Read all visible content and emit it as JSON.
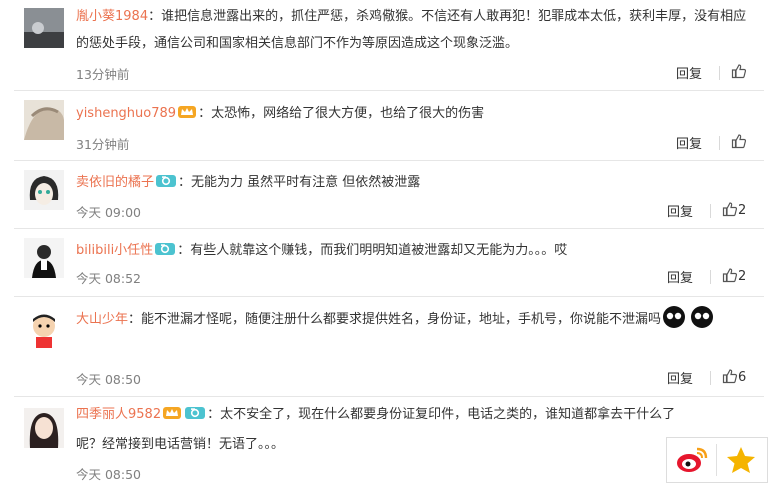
{
  "comments": [
    {
      "user": "胤小葵1984",
      "text": "：谁把信息泄露出来的，抓住严惩，杀鸡儆猴。不信还有人敢再犯！犯罪成本太低，获利丰厚，没有相应的惩处手段，通信公司和国家相关信息部门不作为等原因造成这个现象泛滥。",
      "time": "13分钟前",
      "reply": "回复",
      "likes": ""
    },
    {
      "user": "yishenghuo789",
      "text": "：太恐怖，网络给了很大方便，也给了很大的伤害",
      "time": "31分钟前",
      "reply": "回复",
      "likes": ""
    },
    {
      "user": "卖依旧的橘子",
      "text": "：无能为力 虽然平时有注意 但依然被泄露",
      "time": "今天 09:00",
      "reply": "回复",
      "likes": "2"
    },
    {
      "user": "bilibili小任性",
      "text": "：有些人就靠这个赚钱，而我们明明知道被泄露却又无能为力。。。哎",
      "time": "今天 08:52",
      "reply": "回复",
      "likes": "2"
    },
    {
      "user": "大山少年",
      "text": "：能不泄漏才怪呢，随便注册什么都要求提供姓名，身份证，地址，手机号，你说能不泄漏吗",
      "time": "今天 08:50",
      "reply": "回复",
      "likes": "6"
    },
    {
      "user": "四季丽人9582",
      "text": "：太不安全了，现在什么都要身份证复印件，电话之类的，谁知道都拿去干什么了呢？经常接到电话营销！无语了。。。",
      "time": "今天 08:50",
      "reply": "",
      "likes": ""
    }
  ],
  "colors": {
    "username": "#eb7350",
    "time": "#808080",
    "text": "#333333"
  }
}
